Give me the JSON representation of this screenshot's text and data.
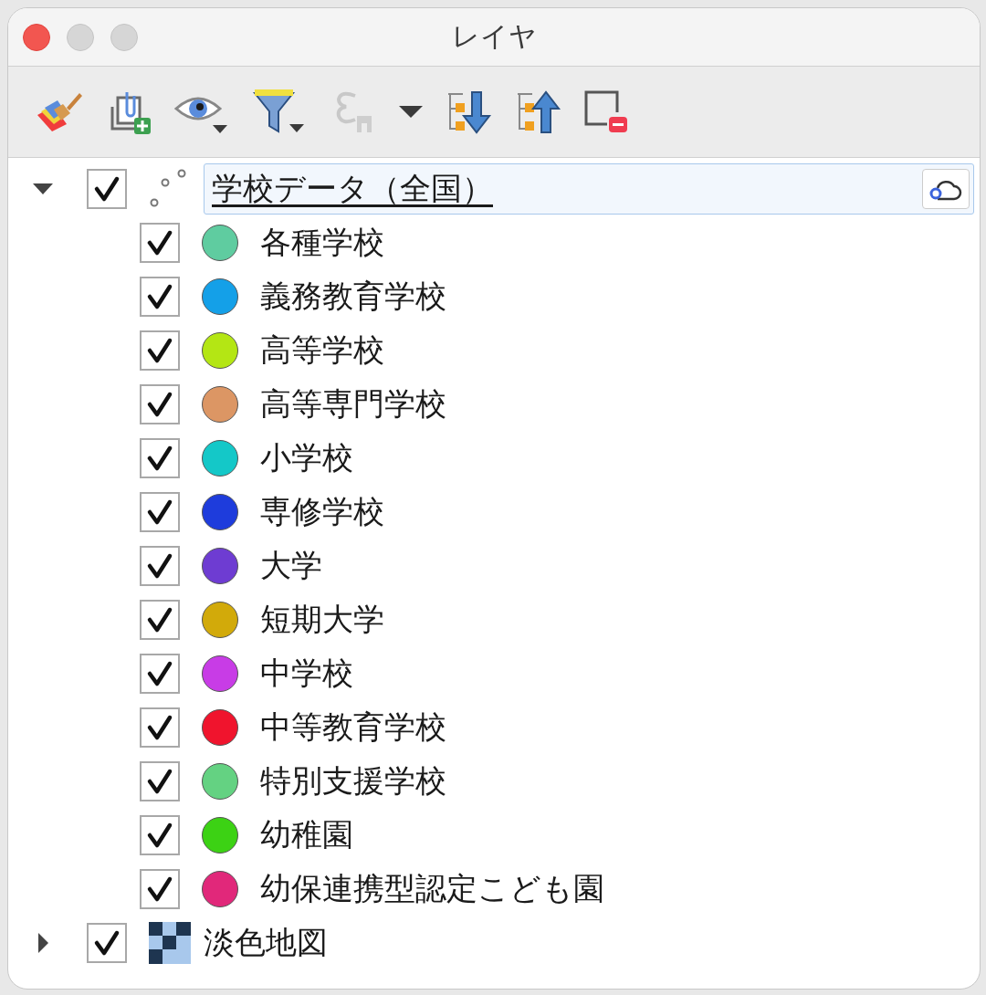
{
  "window": {
    "title": "レイヤ"
  },
  "layers": [
    {
      "name": "学校データ（全国）",
      "kind": "point",
      "expanded": true,
      "checked": true,
      "editing": true,
      "children": [
        {
          "name": "各種学校",
          "checked": true,
          "color": "#5fcca0"
        },
        {
          "name": "義務教育学校",
          "checked": true,
          "color": "#14a0e8"
        },
        {
          "name": "高等学校",
          "checked": true,
          "color": "#b4e614"
        },
        {
          "name": "高等専門学校",
          "checked": true,
          "color": "#dc9664"
        },
        {
          "name": "小学校",
          "checked": true,
          "color": "#14c8c8"
        },
        {
          "name": "専修学校",
          "checked": true,
          "color": "#1e3cdc"
        },
        {
          "name": "大学",
          "checked": true,
          "color": "#6e3cd2"
        },
        {
          "name": "短期大学",
          "checked": true,
          "color": "#d2aa0a"
        },
        {
          "name": "中学校",
          "checked": true,
          "color": "#c83ce6"
        },
        {
          "name": "中等教育学校",
          "checked": true,
          "color": "#f0142d"
        },
        {
          "name": "特別支援学校",
          "checked": true,
          "color": "#64d282"
        },
        {
          "name": "幼稚園",
          "checked": true,
          "color": "#3cd214"
        },
        {
          "name": "幼保連携型認定こども園",
          "checked": true,
          "color": "#e1287a"
        }
      ]
    },
    {
      "name": "淡色地図",
      "kind": "raster",
      "expanded": false,
      "checked": true
    }
  ]
}
